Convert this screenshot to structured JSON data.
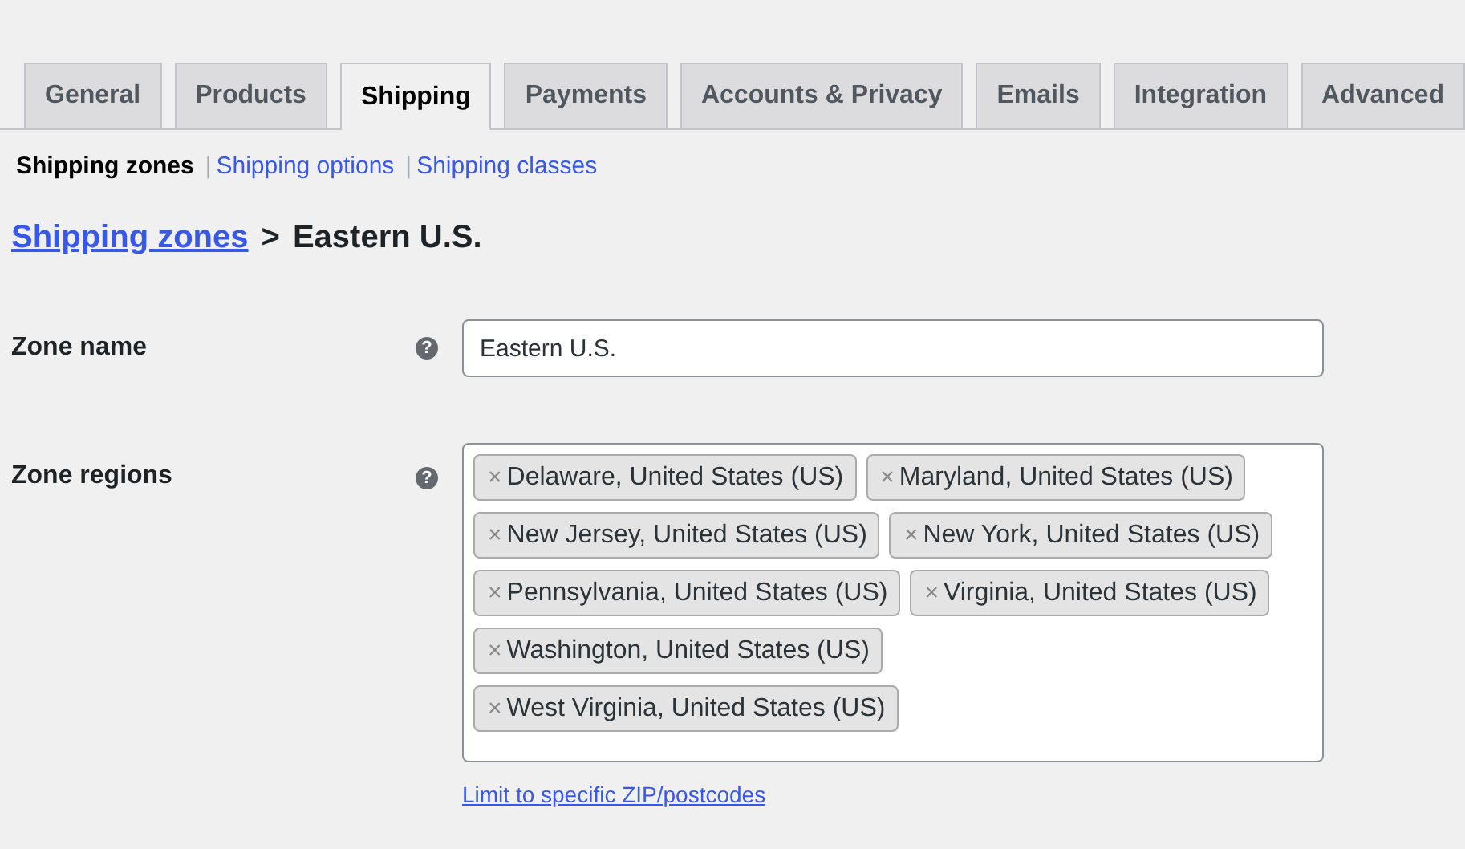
{
  "tabs": [
    {
      "label": "General",
      "selected": false
    },
    {
      "label": "Products",
      "selected": false
    },
    {
      "label": "Shipping",
      "selected": true
    },
    {
      "label": "Payments",
      "selected": false
    },
    {
      "label": "Accounts & Privacy",
      "selected": false
    },
    {
      "label": "Emails",
      "selected": false
    },
    {
      "label": "Integration",
      "selected": false
    },
    {
      "label": "Advanced",
      "selected": false
    }
  ],
  "subnav": [
    {
      "label": "Shipping zones",
      "selected": true
    },
    {
      "separator": "|",
      "label": "Shipping options",
      "selected": false
    },
    {
      "separator": "|",
      "label": "Shipping classes",
      "selected": false
    }
  ],
  "breadcrumb": {
    "link": "Shipping zones",
    "separator": ">",
    "current": "Eastern U.S."
  },
  "zone_name": {
    "label": "Zone name",
    "help": "?",
    "value": "Eastern U.S."
  },
  "zone_regions": {
    "label": "Zone regions",
    "help": "?",
    "chips": [
      {
        "remove": "×",
        "label": "Delaware, United States (US)"
      },
      {
        "remove": "×",
        "label": "Maryland, United States (US)"
      },
      {
        "remove": "×",
        "label": "New Jersey, United States (US)"
      },
      {
        "remove": "×",
        "label": "New York, United States (US)"
      },
      {
        "remove": "×",
        "label": "Pennsylvania, United States (US)"
      },
      {
        "remove": "×",
        "label": "Virginia, United States (US)"
      },
      {
        "remove": "×",
        "label": "Washington, United States (US)"
      },
      {
        "remove": "×",
        "label": "West Virginia, United States (US)"
      }
    ],
    "link": "Limit to specific ZIP/postcodes"
  }
}
